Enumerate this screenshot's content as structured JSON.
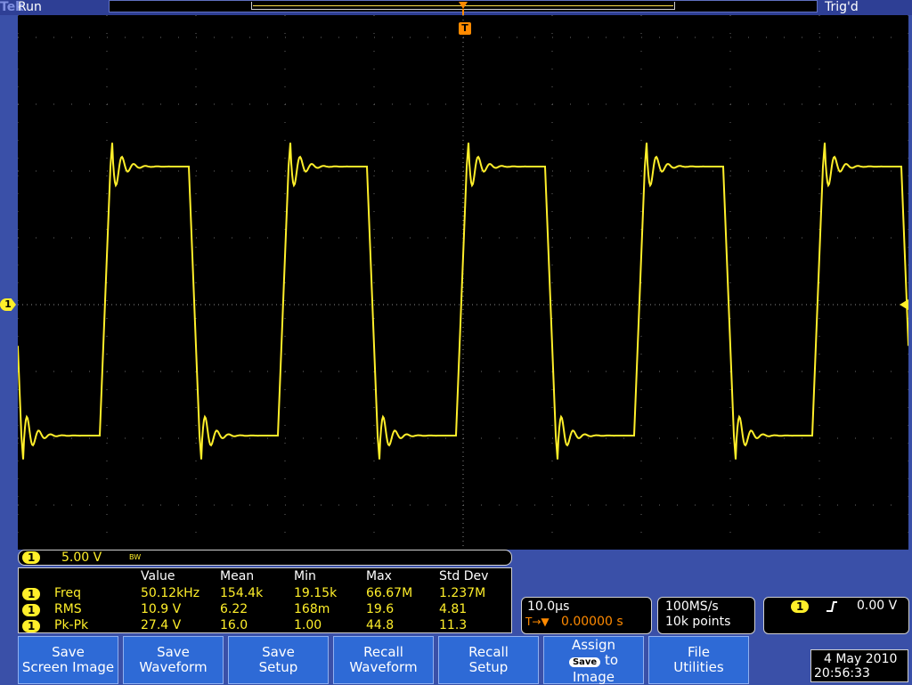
{
  "header": {
    "brand": "Tek",
    "state": "Run",
    "trigger_status": "Trig'd",
    "trigger_position_marker": "T"
  },
  "channel": {
    "number": "1",
    "scale": "5.00 V",
    "bandwidth_icon": "BW",
    "color": "#ffef2a"
  },
  "measurements": {
    "headers": [
      "Value",
      "Mean",
      "Min",
      "Max",
      "Std Dev"
    ],
    "rows": [
      {
        "ch": "1",
        "name": "Freq",
        "value": "50.12kHz",
        "mean": "154.4k",
        "min": "19.15k",
        "max": "66.67M",
        "std": "1.237M"
      },
      {
        "ch": "1",
        "name": "RMS",
        "value": "10.9 V",
        "mean": "6.22",
        "min": "168m",
        "max": "19.6",
        "std": "4.81"
      },
      {
        "ch": "1",
        "name": "Pk-Pk",
        "value": "27.4 V",
        "mean": "16.0",
        "min": "1.00",
        "max": "44.8",
        "std": "11.3"
      }
    ]
  },
  "horizontal": {
    "scale": "10.0µs",
    "delay_icon": "T→▼",
    "delay": "0.00000 s"
  },
  "sampling": {
    "rate": "100MS/s",
    "record": "10k points"
  },
  "trigger": {
    "ch": "1",
    "slope_icon": "rising-edge-icon",
    "level": "0.00 V"
  },
  "buttons": [
    {
      "line1": "Save",
      "line2": "Screen Image"
    },
    {
      "line1": "Save",
      "line2": "Waveform"
    },
    {
      "line1": "Save",
      "line2": "Setup"
    },
    {
      "line1": "Recall",
      "line2": "Waveform"
    },
    {
      "line1": "Recall",
      "line2": "Setup"
    },
    {
      "line1": "Assign",
      "badge": "Save",
      "line2": "to",
      "line3": "Image"
    },
    {
      "line1": "File",
      "line2": "Utilities"
    }
  ],
  "datetime": {
    "date": "4 May 2010",
    "time": "20:56:33"
  },
  "colors": {
    "background": "#3a50a8",
    "button": "#2e6ad6",
    "trace": "#ffef2a",
    "screen": "#000000"
  }
}
